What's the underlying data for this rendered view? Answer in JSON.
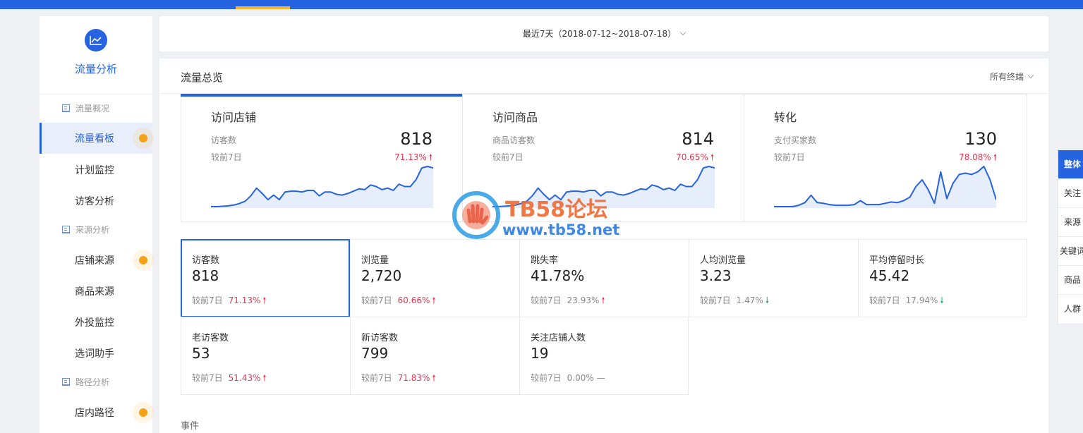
{
  "app": {
    "title": "流量分析"
  },
  "sidebar": {
    "groups": [
      {
        "label": "流量概况"
      },
      {
        "label": "来源分析"
      },
      {
        "label": "路径分析"
      }
    ],
    "items": [
      {
        "label": "流量看板",
        "active": true
      },
      {
        "label": "计划监控"
      },
      {
        "label": "访客分析"
      },
      {
        "label": "店铺来源"
      },
      {
        "label": "商品来源"
      },
      {
        "label": "外投监控"
      },
      {
        "label": "选词助手"
      },
      {
        "label": "店内路径"
      }
    ]
  },
  "date_range": {
    "label": "最近7天（2018-07-12~2018-07-18）"
  },
  "panel": {
    "title": "流量总览",
    "terminal": "所有终端"
  },
  "overview": [
    {
      "title": "访问店铺",
      "metric": "访客数",
      "value": "818",
      "compare": "较前7日",
      "pct": "71.13%",
      "trend": [
        0,
        0,
        0.5,
        1,
        2,
        4,
        7,
        14,
        24,
        17,
        9,
        15,
        9,
        19,
        20,
        20,
        19,
        21,
        21,
        14,
        19,
        19,
        16,
        15,
        17,
        20,
        23,
        22,
        28,
        26,
        22,
        24,
        21,
        29,
        26,
        26,
        35,
        50,
        52,
        50
      ]
    },
    {
      "title": "访问商品",
      "metric": "商品访客数",
      "value": "814",
      "compare": "较前7日",
      "pct": "70.65%",
      "trend": [
        0,
        0,
        0.5,
        1,
        2,
        4,
        7,
        14,
        24,
        16,
        9,
        15,
        9,
        19,
        20,
        20,
        19,
        21,
        21,
        14,
        19,
        19,
        16,
        15,
        17,
        20,
        23,
        22,
        28,
        26,
        22,
        24,
        21,
        29,
        26,
        26,
        35,
        50,
        52,
        50
      ]
    },
    {
      "title": "转化",
      "metric": "支付买家数",
      "value": "130",
      "compare": "较前7日",
      "pct": "78.08%",
      "trend": [
        0,
        0,
        0,
        0,
        2,
        6,
        17,
        6,
        5,
        3,
        2,
        2,
        2,
        3,
        9,
        3,
        3,
        3,
        5,
        7,
        6,
        9,
        14,
        30,
        40,
        25,
        5,
        52,
        12,
        35,
        48,
        50,
        48,
        52,
        60,
        40,
        10
      ]
    }
  ],
  "kpis": [
    {
      "label": "访客数",
      "value": "818",
      "compare": "较前7日",
      "pct": "71.13%",
      "dir": "up"
    },
    {
      "label": "浏览量",
      "value": "2,720",
      "compare": "较前7日",
      "pct": "60.66%",
      "dir": "up"
    },
    {
      "label": "跳失率",
      "value": "41.78%",
      "compare": "较前7日",
      "pct": "23.93%",
      "dir": "up"
    },
    {
      "label": "人均浏览量",
      "value": "3.23",
      "compare": "较前7日",
      "pct": "1.47%",
      "dir": "down"
    },
    {
      "label": "平均停留时长",
      "value": "45.42",
      "compare": "较前7日",
      "pct": "17.94%",
      "dir": "down"
    },
    {
      "label": "老访客数",
      "value": "53",
      "compare": "较前7日",
      "pct": "51.43%",
      "dir": "up"
    },
    {
      "label": "新访客数",
      "value": "799",
      "compare": "较前7日",
      "pct": "71.83%",
      "dir": "up"
    },
    {
      "label": "关注店铺人数",
      "value": "19",
      "compare": "较前7日",
      "pct": "0.00%",
      "dir": "flat"
    }
  ],
  "events": {
    "title": "事件"
  },
  "right_tabs": [
    "整体",
    "关注",
    "来源",
    "关键词",
    "商品",
    "人群"
  ],
  "watermark": {
    "title": "TB58论坛",
    "url": "www.tb58.net"
  },
  "colors": {
    "primary": "#2563e0",
    "accent": "#f4a316",
    "up": "#e8364f",
    "down": "#16b27a"
  },
  "arrows": {
    "up": "🠕",
    "down": "🠗",
    "flat": "—"
  }
}
